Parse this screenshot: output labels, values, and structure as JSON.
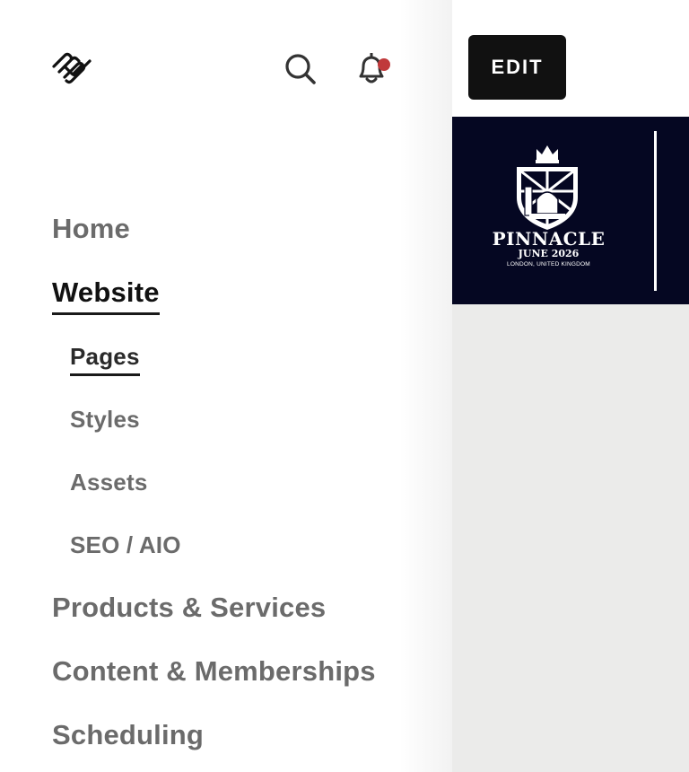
{
  "header": {
    "logo_icon": "squarespace-logo-icon",
    "search_icon": "search-icon",
    "notification_icon": "bell-icon",
    "notification_dot_color": "#c0393b"
  },
  "nav": {
    "items": [
      {
        "label": "Home",
        "level": "top"
      },
      {
        "label": "Website",
        "level": "top",
        "active": true
      },
      {
        "label": "Pages",
        "level": "sub",
        "active": true
      },
      {
        "label": "Styles",
        "level": "sub"
      },
      {
        "label": "Assets",
        "level": "sub"
      },
      {
        "label": "SEO / AIO",
        "level": "sub"
      },
      {
        "label": "Products & Services",
        "level": "top"
      },
      {
        "label": "Content & Memberships",
        "level": "top"
      },
      {
        "label": "Scheduling",
        "level": "top"
      }
    ]
  },
  "preview": {
    "edit_label": "EDIT",
    "banner": {
      "name": "PINNACLE",
      "date": "JUNE 2026",
      "location": "LONDON, UNITED KINGDOM",
      "background": "#050722"
    }
  }
}
